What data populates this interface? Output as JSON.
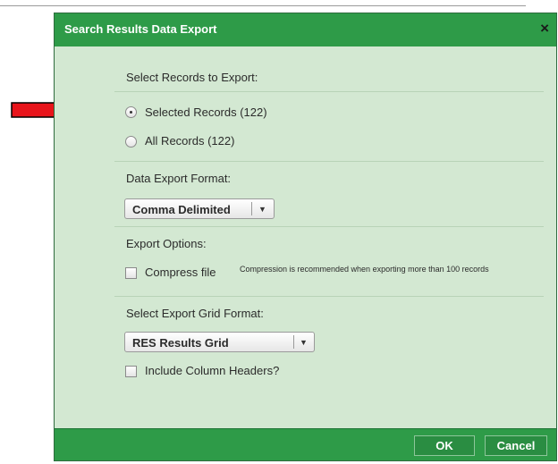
{
  "dialog": {
    "title": "Search Results Data Export",
    "close_symbol": "×"
  },
  "records": {
    "heading": "Select Records to Export:",
    "options": [
      {
        "label": "Selected Records (122)",
        "selected": true
      },
      {
        "label": "All Records (122)",
        "selected": false
      }
    ]
  },
  "format": {
    "heading": "Data Export Format:",
    "selected": "Comma Delimited"
  },
  "options": {
    "heading": "Export Options:",
    "compress_label": "Compress file",
    "compress_checked": false,
    "compress_note": "Compression is recommended when exporting more than 100 records"
  },
  "grid": {
    "heading": "Select Export Grid Format:",
    "selected": "RES Results Grid",
    "headers_label": "Include Column Headers?",
    "headers_checked": false
  },
  "footer": {
    "ok_label": "OK",
    "cancel_label": "Cancel"
  },
  "colors": {
    "titlebar": "#2e9b48",
    "body": "#d3e8d2",
    "arrow": "#e8141b"
  }
}
